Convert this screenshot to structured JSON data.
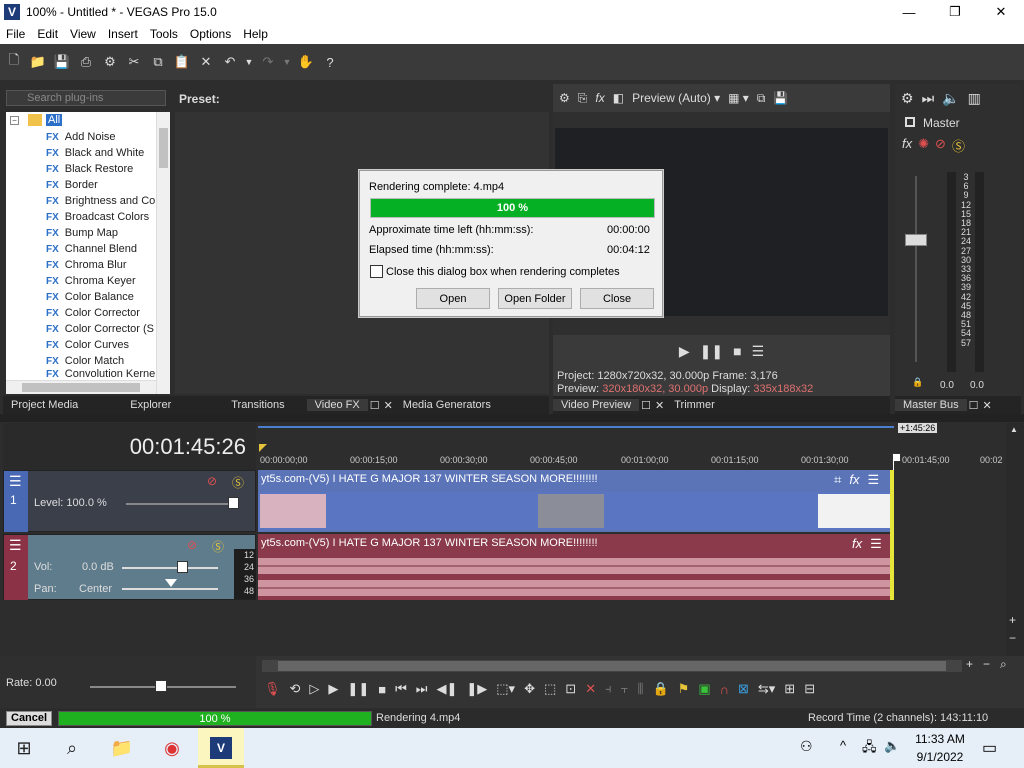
{
  "window": {
    "title": "100% - Untitled * - VEGAS Pro 15.0",
    "logo": "V",
    "minimize": "—",
    "restore": "❐",
    "close": "✕"
  },
  "menu": [
    "File",
    "Edit",
    "View",
    "Insert",
    "Tools",
    "Options",
    "Help"
  ],
  "plugins": {
    "search_placeholder": "Search plug-ins",
    "preset_label": "Preset:",
    "root": "All",
    "items": [
      "Add Noise",
      "Black and White",
      "Black Restore",
      "Border",
      "Brightness and Co",
      "Broadcast Colors",
      "Bump Map",
      "Channel Blend",
      "Chroma Blur",
      "Chroma Keyer",
      "Color Balance",
      "Color Corrector",
      "Color Corrector (S",
      "Color Curves",
      "Color Match",
      "Convolution Kerne"
    ],
    "fx_badge": "FX"
  },
  "tabs": {
    "left": [
      "Project Media",
      "Explorer",
      "Transitions",
      "Video FX",
      "Media Generators"
    ],
    "preview": [
      "Video Preview",
      "Trimmer"
    ],
    "master": [
      "Master Bus"
    ]
  },
  "preview": {
    "mode": "Preview (Auto)",
    "project_label": "Project:",
    "project_value": "1280x720x32, 30.000p",
    "frame_label": "Frame:",
    "frame_value": "3,176",
    "preview_label": "Preview:",
    "preview_value": "320x180x32, 30.000p",
    "display_label": "Display:",
    "display_value": "335x188x32"
  },
  "master": {
    "label": "Master",
    "scale": [
      "3",
      "6",
      "9",
      "12",
      "15",
      "18",
      "21",
      "24",
      "27",
      "30",
      "33",
      "36",
      "39",
      "42",
      "45",
      "48",
      "51",
      "54",
      "57"
    ],
    "left_value": "0.0",
    "right_value": "0.0"
  },
  "dialog": {
    "title": "Rendering complete: 4.mp4",
    "progress_text": "100 %",
    "progress": 1.0,
    "time_left_label": "Approximate time left (hh:mm:ss):",
    "time_left_value": "00:00:00",
    "elapsed_label": "Elapsed time (hh:mm:ss):",
    "elapsed_value": "00:04:12",
    "checkbox_label": "Close this dialog box when rendering completes",
    "open": "Open",
    "open_folder": "Open Folder",
    "close": "Close"
  },
  "timeline": {
    "timecode": "00:01:45:26",
    "end_marker": "+1:45:26",
    "ruler": [
      "00:00:00;00",
      "00:00:15;00",
      "00:00:30;00",
      "00:00:45;00",
      "00:01:00;00",
      "00:01:15;00",
      "00:01:30;00",
      "00:01:45;00",
      "00:02"
    ],
    "video_track": {
      "number": "1",
      "level_label": "Level: 100.0 %",
      "clip_title": "yt5s.com-(V5) I HATE G MAJOR 137 WINTER SEASON MORE!!!!!!!!"
    },
    "audio_track": {
      "number": "2",
      "vol_label": "Vol:",
      "vol_value": "0.0 dB",
      "pan_label": "Pan:",
      "pan_value": "Center",
      "db_scale": [
        "12",
        "24",
        "36",
        "48"
      ],
      "clip_title": "yt5s.com-(V5) I HATE G MAJOR 137 WINTER SEASON MORE!!!!!!!!"
    },
    "rate": "Rate: 0.00"
  },
  "status": {
    "cancel": "Cancel",
    "progress_text": "100 %",
    "progress": 1.0,
    "rendering": "Rendering 4.mp4",
    "record_time": "Record Time (2 channels): 143:11:10"
  },
  "taskbar": {
    "time": "11:33 AM",
    "date": "9/1/2022",
    "app_letter": "V"
  },
  "colors": {
    "video_clip": "#5b74b8",
    "audio_clip": "#8a3a4a",
    "progress_green": "#1fb11f",
    "accent_blue": "#2b6fc9"
  }
}
